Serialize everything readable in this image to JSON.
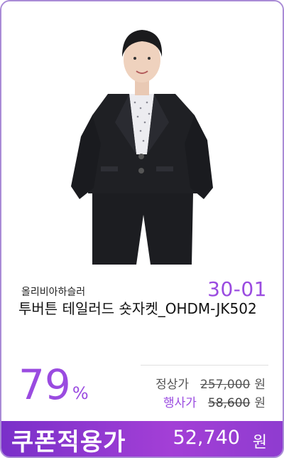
{
  "product": {
    "code": "30-01",
    "brand": "올리비아하슬러",
    "title": "투버튼 테일러드 숏자켓_OHDM-JK502",
    "discount": {
      "value": "79",
      "unit": "%"
    },
    "regular_price": {
      "label": "정상가",
      "value": "257,000",
      "unit": "원"
    },
    "sale_price": {
      "label": "행사가",
      "value": "58,600",
      "unit": "원"
    },
    "coupon": {
      "label": "쿠폰적용가",
      "value": "52,740",
      "unit": "원"
    }
  },
  "colors": {
    "accent": "#9a4be0",
    "banner": "#8a36cf",
    "border": "#a98bd6"
  }
}
